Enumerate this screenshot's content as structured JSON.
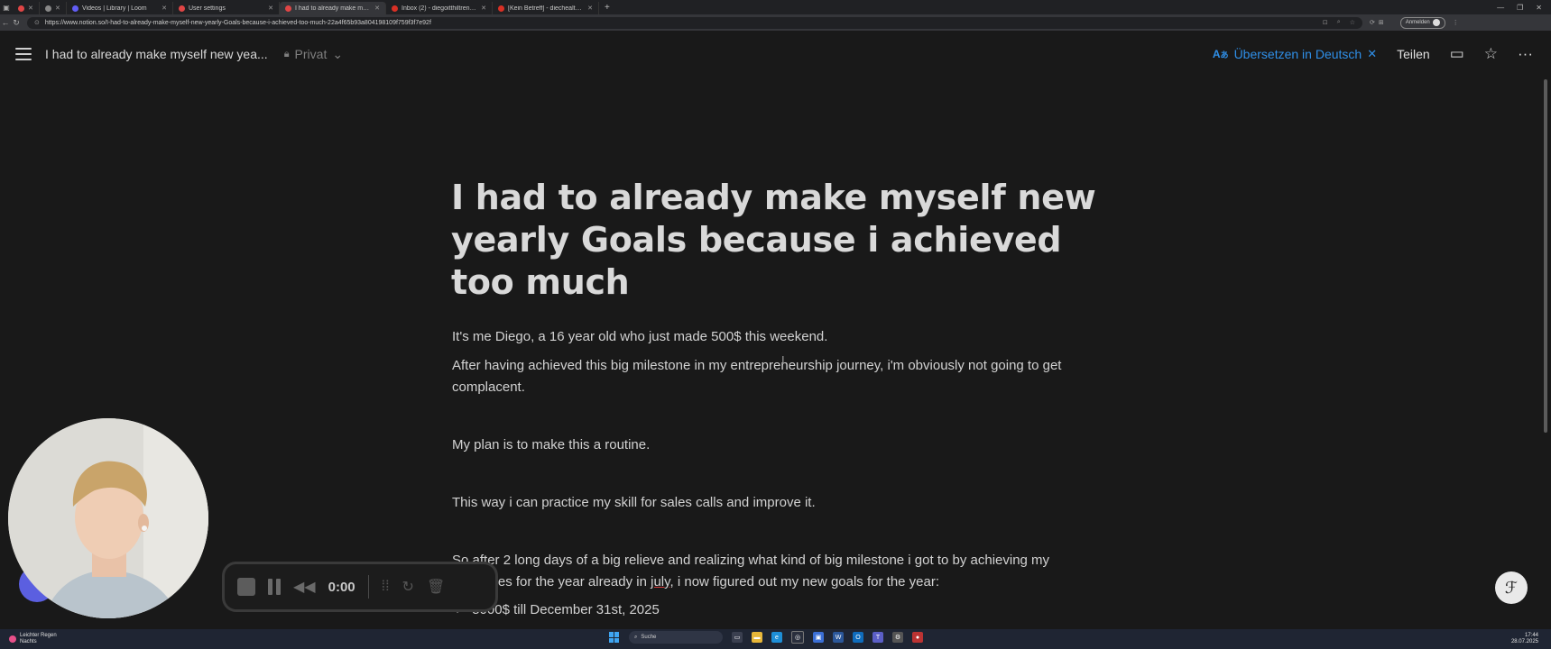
{
  "browser": {
    "tabs": [
      {
        "title": "",
        "color": "#e04545"
      },
      {
        "title": "",
        "color": "#888888"
      },
      {
        "title": "Videos | Library | Loom",
        "color": "#625df5"
      },
      {
        "title": "User settings",
        "color": "#e04545"
      },
      {
        "title": "I had to already make mysel",
        "color": "#e04545"
      },
      {
        "title": "Inbox (2) - diegoitthiltreno@gmai",
        "color": "#d93025"
      },
      {
        "title": "[Kein Betreff] - diechealth@gmail",
        "color": "#d93025"
      }
    ],
    "url": "https://www.notion.so/I-had-to-already-make-myself-new-yearly-Goals-because-i-achieved-too-much-22a4f65b93a804198109f759f3f7e92f",
    "login_label": "Anmelden"
  },
  "notion": {
    "breadcrumb": "I had to already make myself new yea...",
    "privacy": "Privat",
    "translate_label": "Übersetzen in Deutsch",
    "share_label": "Teilen",
    "accent_color": "#2f8fe8"
  },
  "page": {
    "title": "I had to already make myself new yearly Goals because i achieved too much",
    "p1": "It's me Diego, a 16 year old who just made 500$ this weekend.",
    "p2": "After having achieved this big milestone in my entrepreneurship journey, i'm obviously not going to get complacent.",
    "p3": "My plan is to make this a routine.",
    "p4": "This way i can practice my skill for sales calls and improve it.",
    "p5_line1": "So after 2 long days of a big relieve and realizing what kind of big milestone i got to by achieving my",
    "p5_line2_start": "objectives for the year already in ",
    "p5_underlined": "july",
    "p5_line2_end": ", i now figured out my new goals for the year:",
    "bullet1": "5000$ till December 31st, 2025"
  },
  "recorder": {
    "time": "0:00"
  },
  "taskbar": {
    "weather_line1": "Leichter Regen",
    "weather_line2": "Nachts",
    "search_label": "Suche",
    "time": "17:44",
    "date": "28.07.2025"
  }
}
